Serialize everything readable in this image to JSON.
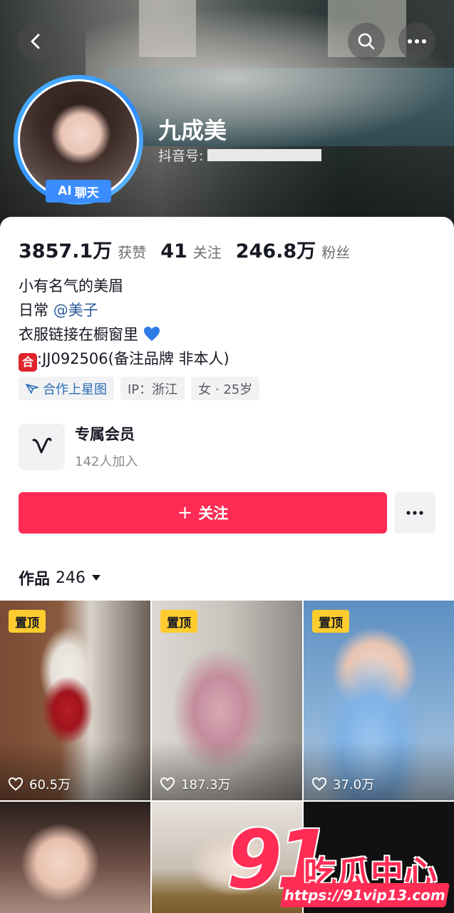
{
  "header": {
    "name": "九成美",
    "douyin_id_label": "抖音号:",
    "ai_badge": {
      "ai": "AI",
      "label": "聊天"
    }
  },
  "stats": [
    {
      "value": "3857.1万",
      "label": "获赞"
    },
    {
      "value": "41",
      "label": "关注"
    },
    {
      "value": "246.8万",
      "label": "粉丝"
    }
  ],
  "bio": {
    "line1": "小有名气的美眉",
    "line2_prefix": "日常 ",
    "line2_mention": "@美子",
    "line3": "衣服链接在橱窗里",
    "line4_badge": "合",
    "line4": ":JJ092506(备注品牌 非本人)"
  },
  "tags": [
    {
      "label": "合作上星图",
      "icon": "star-map-icon"
    },
    {
      "label": "IP：浙江"
    },
    {
      "label": "女 · 25岁"
    }
  ],
  "member": {
    "title": "专属会员",
    "subtitle": "142人加入"
  },
  "actions": {
    "follow": "关注",
    "follow_plus": "+"
  },
  "works": {
    "label": "作品",
    "count": "246"
  },
  "videos": [
    {
      "pinned": "置顶",
      "likes": "60.5万"
    },
    {
      "pinned": "置顶",
      "likes": "187.3万"
    },
    {
      "pinned": "置顶",
      "likes": "37.0万"
    },
    {
      "pinned": "",
      "likes": ""
    },
    {
      "pinned": "",
      "likes": ""
    },
    {
      "pinned": "",
      "likes": ""
    }
  ],
  "watermark": {
    "number": "91",
    "text": "吃瓜中心",
    "url": "https://91vip13.com"
  },
  "colors": {
    "accent": "#fe2c55",
    "pin": "#fecc2e",
    "ai_badge": "#3b8cff",
    "mention": "#2a5b9a"
  }
}
